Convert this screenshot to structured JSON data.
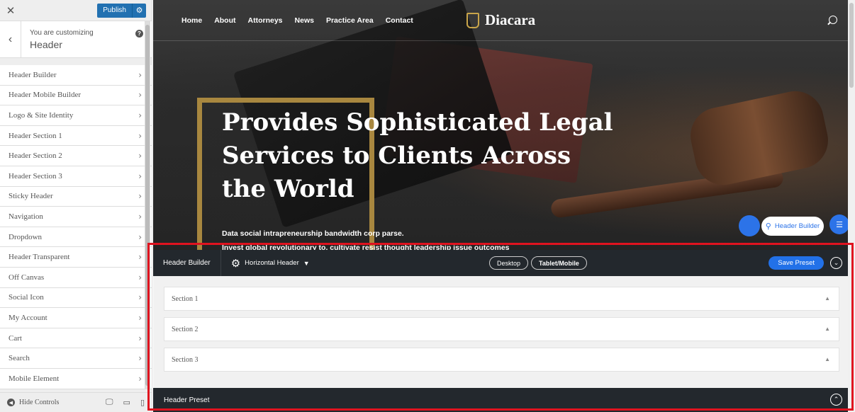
{
  "sidebar": {
    "close_icon": "close-icon",
    "publish_label": "Publish",
    "publish_gear_icon": "gear-icon",
    "customizing_label": "You are customizing",
    "section_title": "Header",
    "items": [
      {
        "label": "Header Builder"
      },
      {
        "label": "Header Mobile Builder"
      },
      {
        "label": "Logo & Site Identity"
      },
      {
        "label": "Header Section 1"
      },
      {
        "label": "Header Section 2"
      },
      {
        "label": "Header Section 3"
      },
      {
        "label": "Sticky Header"
      },
      {
        "label": "Navigation"
      },
      {
        "label": "Dropdown"
      },
      {
        "label": "Header Transparent"
      },
      {
        "label": "Off Canvas"
      },
      {
        "label": "Social Icon"
      },
      {
        "label": "My Account"
      },
      {
        "label": "Cart"
      },
      {
        "label": "Search"
      },
      {
        "label": "Mobile Element"
      }
    ],
    "hide_controls_label": "Hide Controls"
  },
  "site": {
    "nav": [
      "Home",
      "About",
      "Attorneys",
      "News",
      "Practice Area",
      "Contact"
    ],
    "logo_text": "Diacara",
    "hero_title": "Provides Sophisticated Legal Services to Clients Across the World",
    "hero_sub1": "Data social intrapreneurship bandwidth corp parse.",
    "hero_sub2": "Invest global revolutionary to. cultivate resist thought leadership issue outcomes",
    "header_builder_pill": "Header Builder"
  },
  "builder": {
    "title": "Header Builder",
    "layout_label": "Horizontal Header",
    "views": [
      "Desktop",
      "Tablet/Mobile"
    ],
    "save_preset_label": "Save Preset",
    "sections": [
      "Section 1",
      "Section 2",
      "Section 3"
    ],
    "preset_title": "Header Preset"
  },
  "colors": {
    "accent": "#2271e8",
    "highlight_border": "#e0131f",
    "dark_bar": "#23282d",
    "gold": "#a8873f"
  }
}
